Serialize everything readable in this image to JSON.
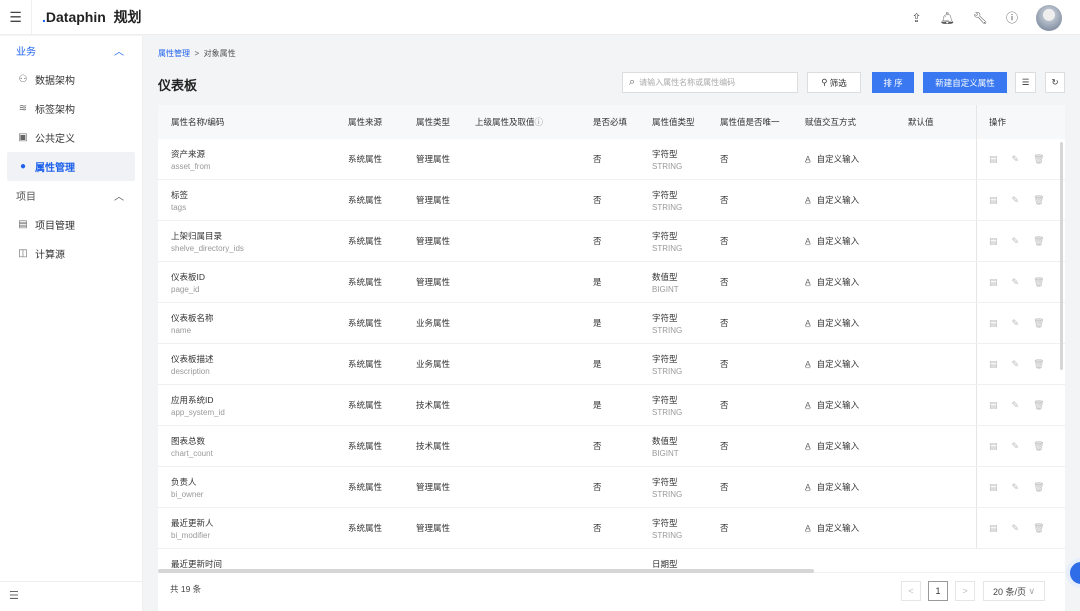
{
  "header": {
    "menu_icon": "hamburger-icon",
    "logo": "Dataphin",
    "product": "规划",
    "icons": [
      "upload-icon",
      "bell-icon",
      "wrench-icon",
      "help-icon"
    ]
  },
  "sidebar": {
    "groups": [
      {
        "label": "业务",
        "items": [
          {
            "label": "数据架构",
            "icon": "hierarchy-icon"
          },
          {
            "label": "标签架构",
            "icon": "layers-icon"
          },
          {
            "label": "公共定义",
            "icon": "book-icon"
          },
          {
            "label": "属性管理",
            "icon": "attribute-icon",
            "active": true
          }
        ]
      },
      {
        "label": "项目",
        "items": [
          {
            "label": "项目管理",
            "icon": "folder-icon"
          },
          {
            "label": "计算源",
            "icon": "compute-icon"
          }
        ]
      }
    ]
  },
  "breadcrumb": {
    "parent": "属性管理",
    "sep": ">",
    "current": "对象属性"
  },
  "page_title": "仪表板",
  "toolbar": {
    "search_placeholder": "请输入属性名称或属性编码",
    "filter": "筛选",
    "sort": "排 序",
    "create": "新建自定义属性"
  },
  "table": {
    "columns": [
      "属性名称/编码",
      "属性来源",
      "属性类型",
      "上级属性及取值",
      "是否必填",
      "属性值类型",
      "属性值是否唯一",
      "赋值交互方式",
      "默认值",
      "操作"
    ],
    "rows": [
      {
        "name": "资产来源",
        "code": "asset_from",
        "source": "系统属性",
        "type": "管理属性",
        "required": "否",
        "vtype": "字符型",
        "vcode": "STRING",
        "unique": "否",
        "mode": "自定义输入"
      },
      {
        "name": "标签",
        "code": "tags",
        "source": "系统属性",
        "type": "管理属性",
        "required": "否",
        "vtype": "字符型",
        "vcode": "STRING",
        "unique": "否",
        "mode": "自定义输入"
      },
      {
        "name": "上架归属目录",
        "code": "shelve_directory_ids",
        "source": "系统属性",
        "type": "管理属性",
        "required": "否",
        "vtype": "字符型",
        "vcode": "STRING",
        "unique": "否",
        "mode": "自定义输入"
      },
      {
        "name": "仪表板ID",
        "code": "page_id",
        "source": "系统属性",
        "type": "管理属性",
        "required": "是",
        "vtype": "数值型",
        "vcode": "BIGINT",
        "unique": "否",
        "mode": "自定义输入"
      },
      {
        "name": "仪表板名称",
        "code": "name",
        "source": "系统属性",
        "type": "业务属性",
        "required": "是",
        "vtype": "字符型",
        "vcode": "STRING",
        "unique": "否",
        "mode": "自定义输入"
      },
      {
        "name": "仪表板描述",
        "code": "description",
        "source": "系统属性",
        "type": "业务属性",
        "required": "是",
        "vtype": "字符型",
        "vcode": "STRING",
        "unique": "否",
        "mode": "自定义输入"
      },
      {
        "name": "应用系统ID",
        "code": "app_system_id",
        "source": "系统属性",
        "type": "技术属性",
        "required": "是",
        "vtype": "字符型",
        "vcode": "STRING",
        "unique": "否",
        "mode": "自定义输入"
      },
      {
        "name": "图表总数",
        "code": "chart_count",
        "source": "系统属性",
        "type": "技术属性",
        "required": "否",
        "vtype": "数值型",
        "vcode": "BIGINT",
        "unique": "否",
        "mode": "自定义输入"
      },
      {
        "name": "负责人",
        "code": "bi_owner",
        "source": "系统属性",
        "type": "管理属性",
        "required": "否",
        "vtype": "字符型",
        "vcode": "STRING",
        "unique": "否",
        "mode": "自定义输入"
      },
      {
        "name": "最近更新人",
        "code": "bi_modifier",
        "source": "系统属性",
        "type": "管理属性",
        "required": "否",
        "vtype": "字符型",
        "vcode": "STRING",
        "unique": "否",
        "mode": "自定义输入"
      },
      {
        "name": "最近更新时间",
        "code": "",
        "source": "",
        "type": "",
        "required": "",
        "vtype": "日期型",
        "vcode": "",
        "unique": "",
        "mode": ""
      }
    ]
  },
  "pagination": {
    "total": "共 19 条",
    "prev": "<",
    "page": "1",
    "next": ">",
    "page_size": "20 条/页"
  },
  "colors": {
    "accent": "#3a78f2"
  }
}
